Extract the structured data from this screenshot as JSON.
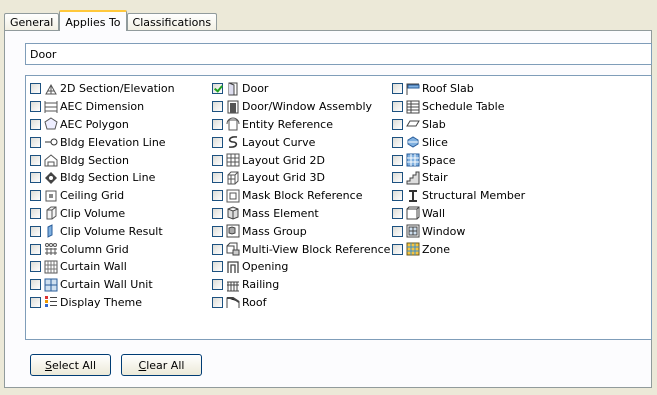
{
  "tabs": [
    {
      "label": "General",
      "active": false
    },
    {
      "label": "Applies To",
      "active": true
    },
    {
      "label": "Classifications",
      "active": false
    }
  ],
  "name_field": {
    "value": "Door"
  },
  "columns": [
    [
      {
        "label": "2D Section/Elevation",
        "icon": "section-elevation-icon",
        "checked": false
      },
      {
        "label": "AEC Dimension",
        "icon": "dimension-icon",
        "checked": false
      },
      {
        "label": "AEC Polygon",
        "icon": "polygon-icon",
        "checked": false
      },
      {
        "label": "Bldg Elevation Line",
        "icon": "elevation-line-icon",
        "checked": false
      },
      {
        "label": "Bldg Section",
        "icon": "bldg-section-icon",
        "checked": false
      },
      {
        "label": "Bldg Section Line",
        "icon": "section-line-icon",
        "checked": false
      },
      {
        "label": "Ceiling Grid",
        "icon": "ceiling-grid-icon",
        "checked": false
      },
      {
        "label": "Clip Volume",
        "icon": "clip-volume-icon",
        "checked": false
      },
      {
        "label": "Clip Volume Result",
        "icon": "clip-volume-result-icon",
        "checked": false
      },
      {
        "label": "Column Grid",
        "icon": "column-grid-icon",
        "checked": false
      },
      {
        "label": "Curtain Wall",
        "icon": "curtain-wall-icon",
        "checked": false
      },
      {
        "label": "Curtain Wall Unit",
        "icon": "curtain-wall-unit-icon",
        "checked": false
      },
      {
        "label": "Display Theme",
        "icon": "display-theme-icon",
        "checked": false
      }
    ],
    [
      {
        "label": "Door",
        "icon": "door-icon",
        "checked": true
      },
      {
        "label": "Door/Window Assembly",
        "icon": "door-window-assembly-icon",
        "checked": false
      },
      {
        "label": "Entity Reference",
        "icon": "entity-reference-icon",
        "checked": false
      },
      {
        "label": "Layout Curve",
        "icon": "layout-curve-icon",
        "checked": false
      },
      {
        "label": "Layout Grid 2D",
        "icon": "layout-grid-2d-icon",
        "checked": false
      },
      {
        "label": "Layout Grid 3D",
        "icon": "layout-grid-3d-icon",
        "checked": false
      },
      {
        "label": "Mask Block Reference",
        "icon": "mask-block-icon",
        "checked": false
      },
      {
        "label": "Mass Element",
        "icon": "mass-element-icon",
        "checked": false
      },
      {
        "label": "Mass Group",
        "icon": "mass-group-icon",
        "checked": false
      },
      {
        "label": "Multi-View Block Reference",
        "icon": "multi-view-block-icon",
        "checked": false
      },
      {
        "label": "Opening",
        "icon": "opening-icon",
        "checked": false
      },
      {
        "label": "Railing",
        "icon": "railing-icon",
        "checked": false
      },
      {
        "label": "Roof",
        "icon": "roof-icon",
        "checked": false
      }
    ],
    [
      {
        "label": "Roof Slab",
        "icon": "roof-slab-icon",
        "checked": false
      },
      {
        "label": "Schedule Table",
        "icon": "schedule-table-icon",
        "checked": false
      },
      {
        "label": "Slab",
        "icon": "slab-icon",
        "checked": false
      },
      {
        "label": "Slice",
        "icon": "slice-icon",
        "checked": false
      },
      {
        "label": "Space",
        "icon": "space-icon",
        "checked": false
      },
      {
        "label": "Stair",
        "icon": "stair-icon",
        "checked": false
      },
      {
        "label": "Structural Member",
        "icon": "structural-member-icon",
        "checked": false
      },
      {
        "label": "Wall",
        "icon": "wall-icon",
        "checked": false
      },
      {
        "label": "Window",
        "icon": "window-icon",
        "checked": false
      },
      {
        "label": "Zone",
        "icon": "zone-icon",
        "checked": false
      }
    ]
  ],
  "buttons": {
    "select_all": {
      "mnemonic": "S",
      "rest": "elect All"
    },
    "clear_all": {
      "mnemonic": "C",
      "rest": "lear All"
    }
  },
  "colors": {
    "tab_highlight": "#ffc83c",
    "check": "#21a121",
    "border": "#7f9db9"
  }
}
